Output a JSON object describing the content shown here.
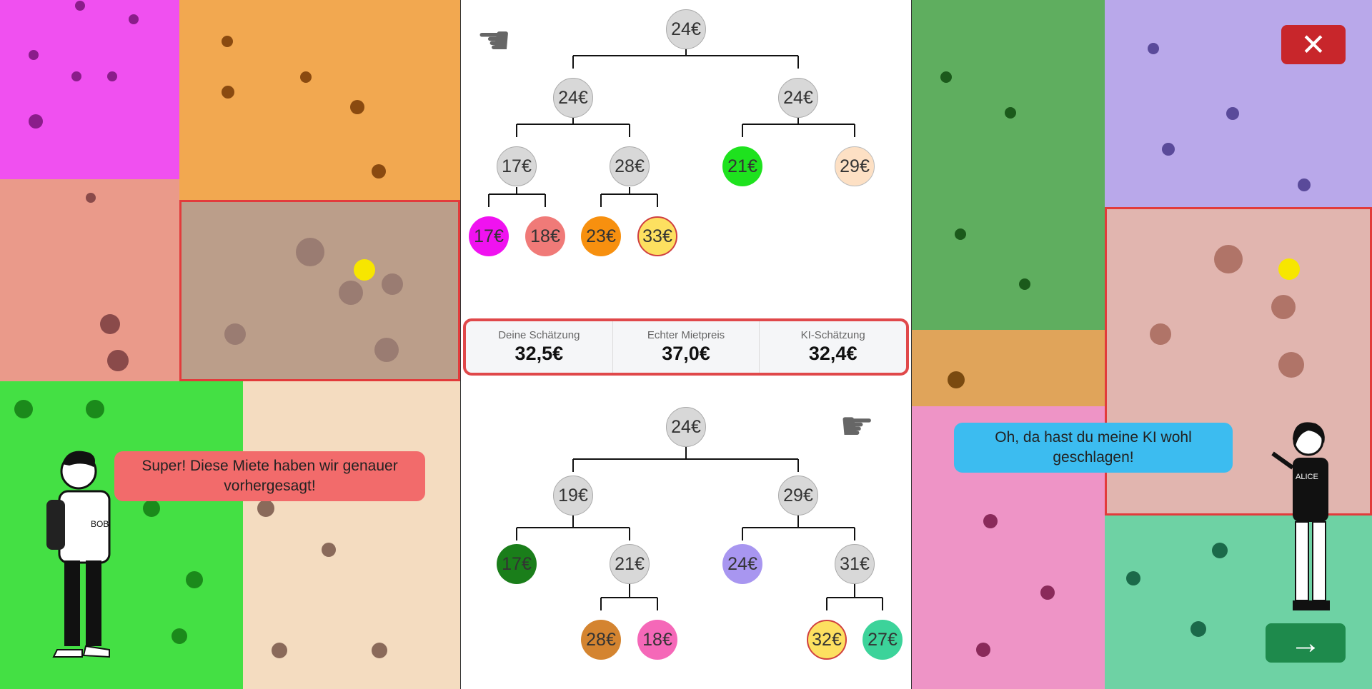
{
  "left_panel": {
    "bubble_text": "Super! Diese Miete haben wir genauer vorhergesagt!",
    "character_name": "BOB"
  },
  "right_panel": {
    "bubble_text": "Oh, da hast du meine KI wohl geschlagen!",
    "character_name": "ALICE"
  },
  "score": {
    "your_label": "Deine Schätzung",
    "your_value": "32,5€",
    "real_label": "Echter Mietpreis",
    "real_value": "37,0€",
    "ai_label": "KI-Schätzung",
    "ai_value": "32,4€"
  },
  "top_tree": {
    "root": "24€",
    "l": "24€",
    "r": "24€",
    "ll": "17€",
    "lr": "28€",
    "rl": "21€",
    "rr": "29€",
    "lll": "17€",
    "llr": "18€",
    "lrl": "23€",
    "lrr": "33€"
  },
  "bottom_tree": {
    "root": "24€",
    "l": "19€",
    "r": "29€",
    "ll": "17€",
    "lr": "21€",
    "rl": "24€",
    "rr": "31€",
    "lrl": "28€",
    "lrr": "18€",
    "rrl": "32€",
    "rrr": "27€"
  },
  "colors": {
    "magenta": "#f050f0",
    "orange": "#f2a850",
    "salmon": "#ea9a8a",
    "green": "#44e044",
    "beige": "#f4dcc0",
    "dkgreen": "#5fae5f",
    "lavender": "#b9a8ea",
    "pink": "#ee94c6",
    "mint": "#6ed2a4",
    "close": "#c8262b",
    "next": "#1e8a4c"
  }
}
